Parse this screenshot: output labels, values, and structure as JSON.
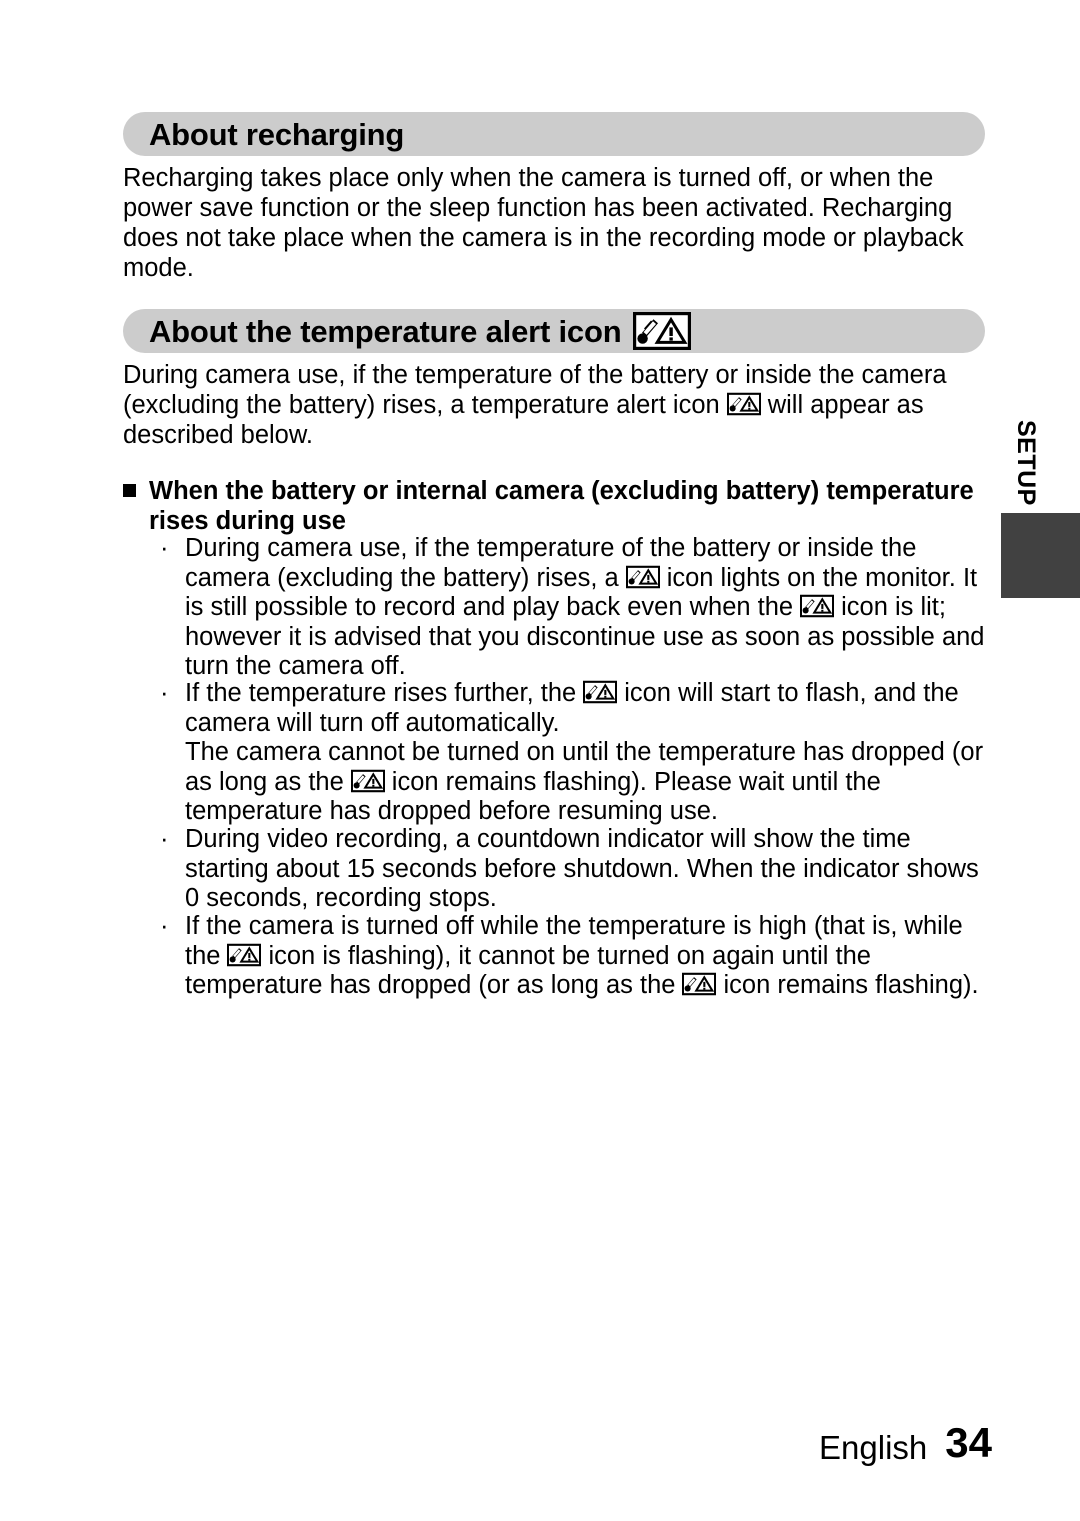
{
  "document": {
    "sections": [
      {
        "heading": "About recharging",
        "paragraph": "Recharging takes place only when the camera is turned off, or when the power save function or the sleep function has been activated. Recharging does not take place when the camera is in the recording mode or playback mode."
      },
      {
        "heading": "About the temperature alert icon",
        "heading_icon": "temperature-alert-icon",
        "paragraph_part1": "During camera use, if the temperature of the battery or inside the camera (excluding the battery) rises, a temperature alert icon",
        "paragraph_part2": "will appear as described below."
      }
    ],
    "subsection": {
      "marker": "square-bullet",
      "title_line1": "When the battery or internal camera (excluding battery) temperature",
      "title_line2": "rises during use",
      "bullets": [
        {
          "marker": "·",
          "part1": "During camera use, if the temperature of the battery or inside the camera (excluding the battery) rises, a",
          "icon": "temperature-alert-icon",
          "part2": "icon lights on the monitor. It is still possible to record and play back even when the",
          "icon2": "temperature-alert-icon",
          "part3": "icon is lit; however it is advised that you discontinue use as soon as possible and turn the camera off."
        },
        {
          "marker": "·",
          "part1": "If the temperature rises further, the",
          "icon": "temperature-alert-icon",
          "part2": "icon will start to flash, and the camera will turn off automatically."
        },
        {
          "marker": "·",
          "part1": "During video recording, a countdown indicator will show the time starting about 15 seconds before shutdown. When the indicator shows 0 seconds, recording stops."
        },
        {
          "marker": "·",
          "part1": "If the camera is turned off while the temperature is high (that is, while the",
          "icon": "temperature-alert-icon",
          "part2": "icon is flashing), it cannot be turned on again until the temperature has dropped (or as long as the",
          "icon2": "temperature-alert-icon",
          "part3": "icon remains flashing)."
        }
      ],
      "continuation_block": {
        "part1": "The camera cannot be turned on until the temperature has dropped (or as long as the",
        "icon": "temperature-alert-icon",
        "part2": "icon remains flashing). Please wait until the temperature has dropped before resuming use."
      }
    },
    "side_tab": {
      "label": "SETUP",
      "tab_color": "#414141"
    },
    "footer": {
      "language": "English",
      "page_number": "34"
    },
    "colors": {
      "heading_bar": "#cccccc",
      "text": "#000000",
      "background": "#ffffff"
    }
  }
}
